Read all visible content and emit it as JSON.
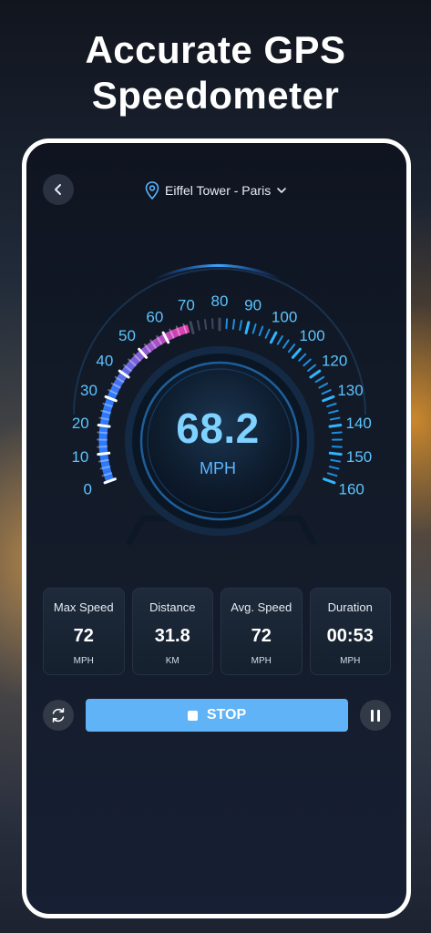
{
  "headline": {
    "line1": "Accurate GPS",
    "line2": "Speedometer"
  },
  "header": {
    "back_icon": "chevron-left-icon",
    "location": "Eiffel Tower - Paris",
    "location_icon": "map-pin-icon",
    "dropdown_icon": "chevron-down-icon"
  },
  "gauge": {
    "ticks": [
      "0",
      "10",
      "20",
      "30",
      "40",
      "50",
      "60",
      "70",
      "80",
      "90",
      "100",
      "100",
      "120",
      "130",
      "140",
      "150",
      "160"
    ],
    "min": 0,
    "max": 160,
    "speed": "68.2",
    "unit": "MPH",
    "needle_fraction": 0.43
  },
  "stats": [
    {
      "label": "Max Speed",
      "value": "72",
      "unit": "MPH"
    },
    {
      "label": "Distance",
      "value": "31.8",
      "unit": "KM"
    },
    {
      "label": "Avg. Speed",
      "value": "72",
      "unit": "MPH"
    },
    {
      "label": "Duration",
      "value": "00:53",
      "unit": "MPH"
    }
  ],
  "controls": {
    "stop_label": "STOP",
    "reset_icon": "refresh-icon",
    "pause_icon": "pause-icon",
    "stop_icon": "stop-icon"
  },
  "colors": {
    "accent": "#5fb3f6",
    "gauge_label": "#5cc4ff",
    "gauge_active_blue": "#2f7bff",
    "gauge_active_pink": "#e23cb0"
  }
}
